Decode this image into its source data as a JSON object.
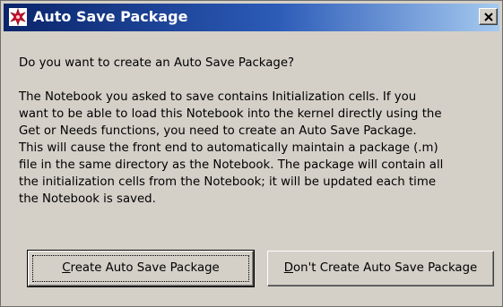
{
  "window": {
    "title": "Auto Save Package",
    "app_icon": "mathematica-star-icon",
    "close_label": "close"
  },
  "message": {
    "question": "Do you want to create an Auto Save Package?",
    "body_lines": [
      "The Notebook you asked to save contains Initialization cells.  If you",
      "want to be able to load this Notebook into the kernel directly using the",
      "Get or Needs functions, you need to create an Auto Save Package.",
      "This will cause the front end to automatically maintain a package (.m)",
      "file in the same directory as the Notebook.  The package will contain all",
      "the initialization cells from the Notebook; it will be updated each time",
      "the Notebook is saved."
    ]
  },
  "buttons": {
    "create": {
      "mnemonic": "C",
      "rest": "reate Auto Save Package"
    },
    "dont_create": {
      "mnemonic": "D",
      "rest": "on't Create Auto Save Package"
    }
  },
  "colors": {
    "title_start": "#0a246a",
    "title_end": "#a6caf0",
    "dialog_bg": "#d4d0c8",
    "icon_red": "#c8102e"
  }
}
